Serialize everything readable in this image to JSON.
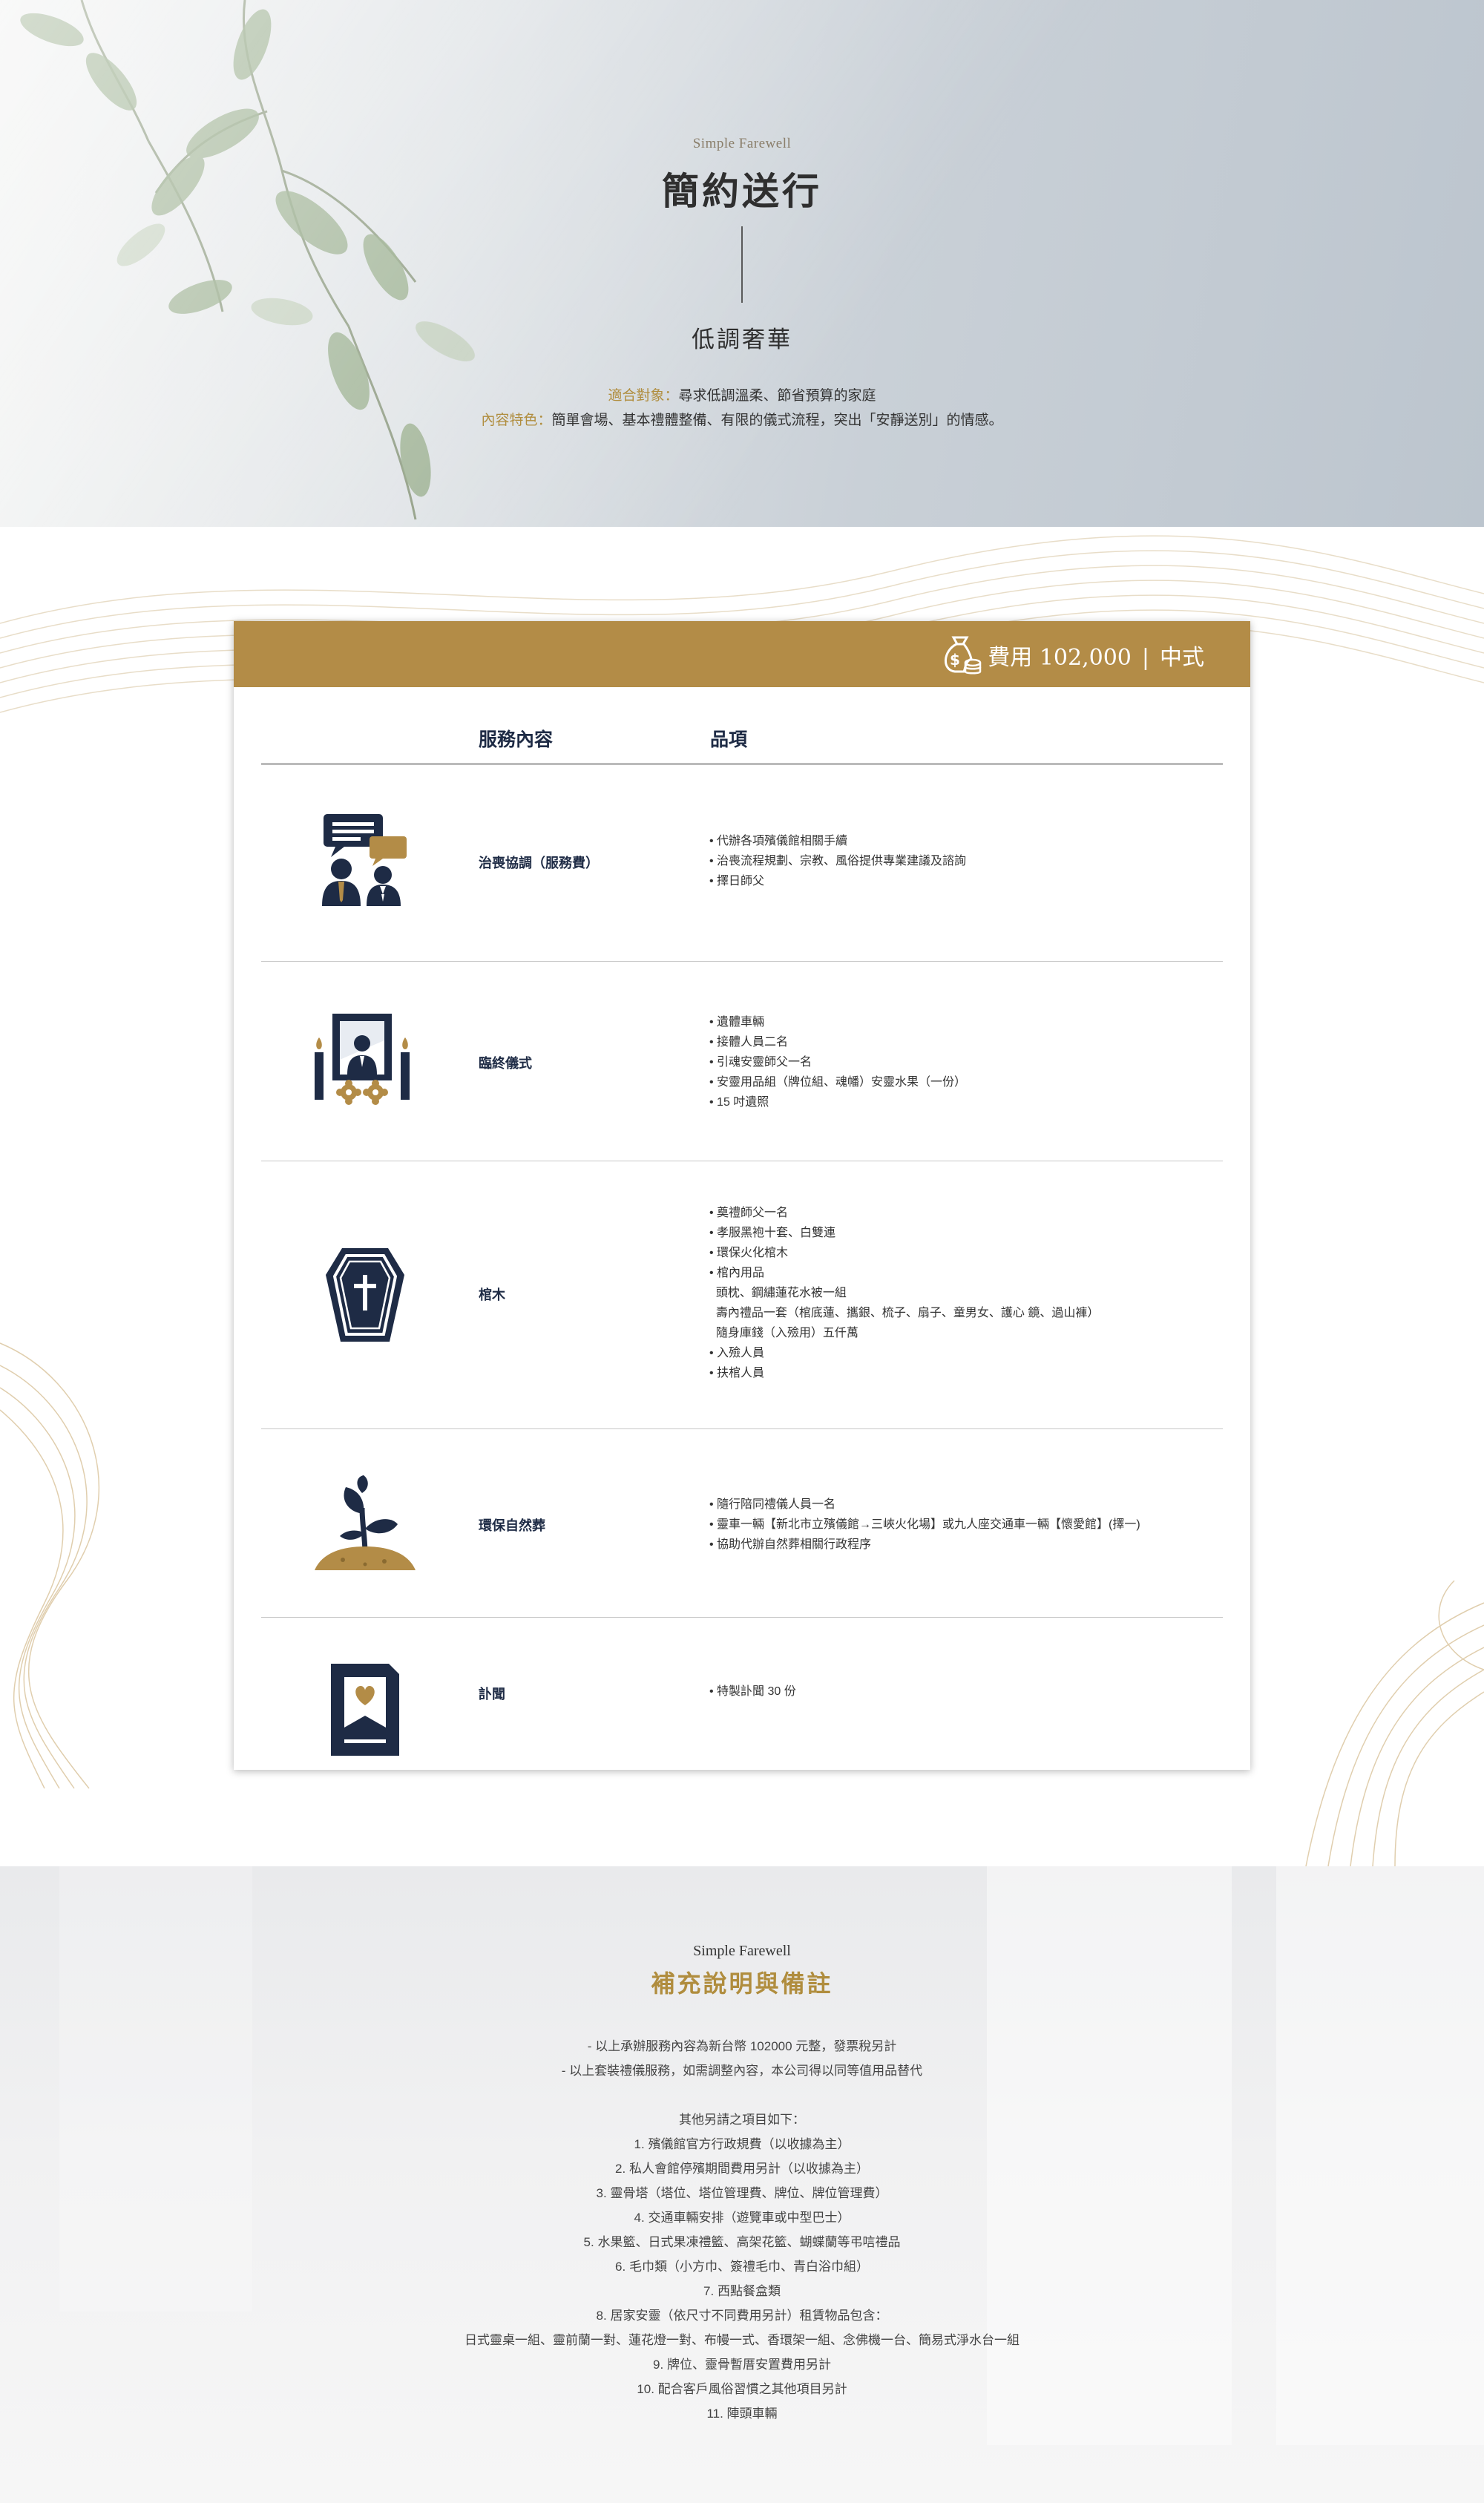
{
  "hero": {
    "subtitle": "Simple Farewell",
    "title": "簡約送行",
    "tagline": "低調奢華",
    "suitable_label": "適合對象：",
    "suitable_text": "尋求低調溫柔、節省預算的家庭",
    "content_label": "內容特色：",
    "content_text": "簡單會場、基本禮體整備、有限的儀式流程，突出「安靜送別」的情感。"
  },
  "card": {
    "price_label": "費用 102,000",
    "price_sep": "|",
    "price_style": "中式",
    "col_service": "服務內容",
    "col_items": "品項",
    "rows": [
      {
        "icon": "consultation-icon",
        "name": "治喪協調（服務費）",
        "items": [
          "• 代辦各項殯儀館相關手續",
          "• 治喪流程規劃、宗教、風俗提供專業建議及諮詢",
          "• 擇日師父"
        ]
      },
      {
        "icon": "memorial-altar-icon",
        "name": "臨終儀式",
        "items": [
          "• 遺體車輛",
          "• 接體人員二名",
          "• 引魂安靈師父一名",
          "• 安靈用品組（牌位組、魂幡）安靈水果（一份）",
          "• 15 吋遺照"
        ]
      },
      {
        "icon": "coffin-icon",
        "name": "棺木",
        "items": [
          "• 奠禮師父一名",
          "• 孝服黑袍十套、白雙連",
          "• 環保火化棺木",
          "• 棺內用品",
          "  頭枕、鋼繡蓮花水被一組",
          "  壽內禮品一套（棺底蓮、攜銀、梳子、扇子、童男女、護心 鏡、過山褲）",
          "  隨身庫錢（入殮用）五仟萬",
          "• 入殮人員",
          "• 扶棺人員"
        ]
      },
      {
        "icon": "sprout-icon",
        "name": "環保自然葬",
        "items": [
          "• 隨行陪同禮儀人員一名",
          "• 靈車一輛【新北市立殯儀館→三峽火化場】或九人座交通車一輛【懷愛館】(擇一)",
          "• 協助代辦自然葬相關行政程序"
        ]
      },
      {
        "icon": "obituary-card-icon",
        "name": "訃聞",
        "items": [
          "• 特製訃聞 30 份"
        ]
      }
    ]
  },
  "notes": {
    "subtitle": "Simple Farewell",
    "title": "補充說明與備註",
    "lines": [
      "- 以上承辦服務內容為新台幣 102000 元整，發票稅另計",
      "- 以上套裝禮儀服務，如需調整內容，本公司得以同等值用品替代",
      "",
      "其他另請之項目如下：",
      "1. 殯儀館官方行政規費（以收據為主）",
      "2. 私人會館停殯期間費用另計（以收據為主）",
      "3. 靈骨塔（塔位、塔位管理費、牌位、牌位管理費）",
      "4. 交通車輛安排（遊覽車或中型巴士）",
      "5. 水果籃、日式果凍禮籃、高架花籃、蝴蝶蘭等弔唁禮品",
      "6. 毛巾類（小方巾、簽禮毛巾、青白浴巾組）",
      "7. 西點餐盒類",
      "8. 居家安靈（依尺寸不同費用另計）租賃物品包含：",
      "日式靈桌一組、靈前蘭一對、蓮花燈一對、布幔一式、香環架一組、念佛機一台、簡易式淨水台一組",
      "9. 牌位、靈骨暫厝安置費用另計",
      "10. 配合客戶風俗習慣之其他項目另計",
      "11. 陣頭車輛"
    ]
  },
  "colors": {
    "gold": "#b38c47",
    "navy": "#1e2b45",
    "accent_text": "#b08d3e"
  }
}
